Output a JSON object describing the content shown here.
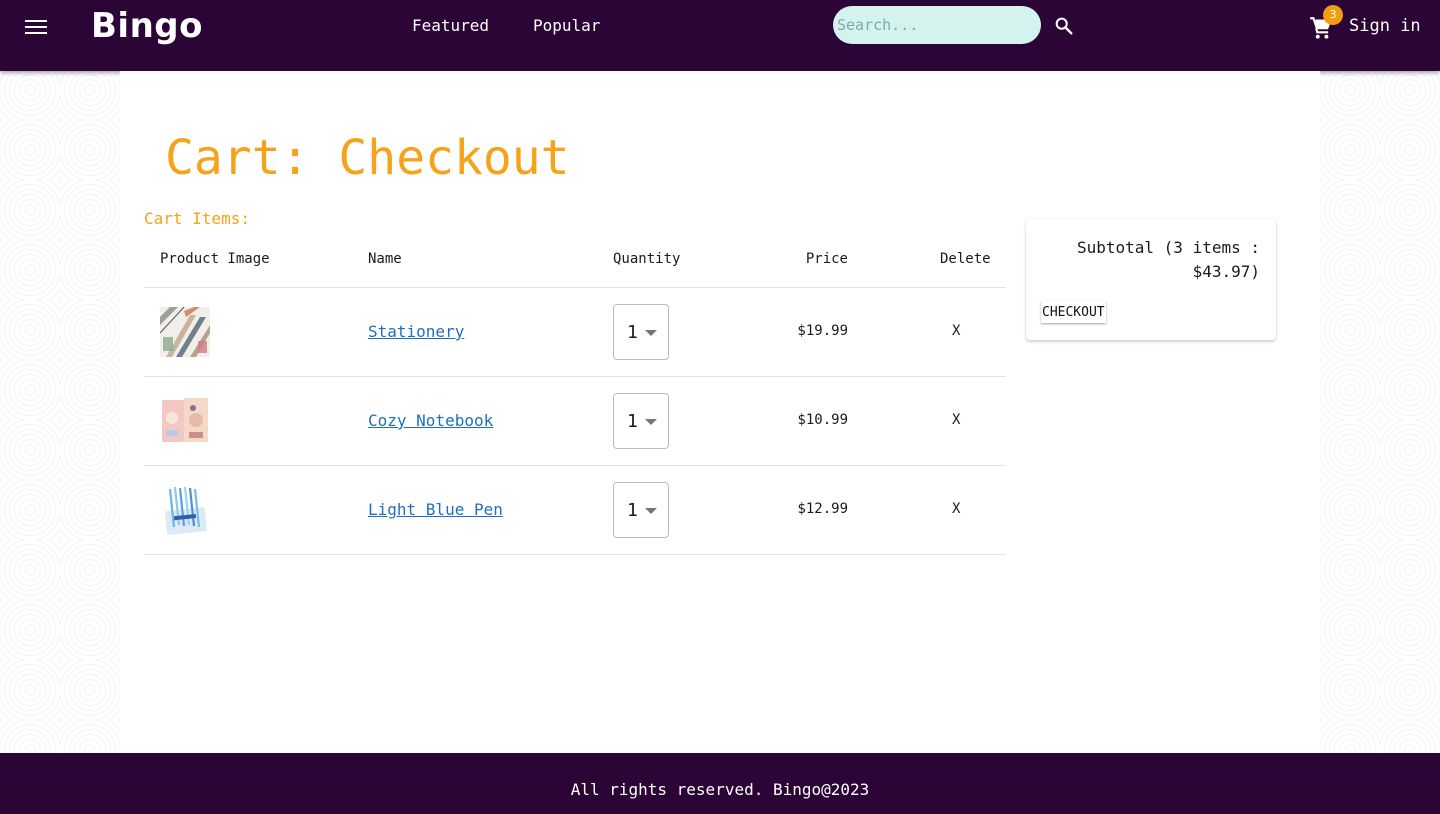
{
  "header": {
    "logo": "Bingo",
    "nav": [
      "Featured",
      "Popular"
    ],
    "search_placeholder": "Search...",
    "cart_count": "3",
    "sign_in": "Sign in"
  },
  "page": {
    "title": "Cart: Checkout",
    "section_label": "Cart Items:"
  },
  "table": {
    "headers": {
      "image": "Product Image",
      "name": "Name",
      "quantity": "Quantity",
      "price": "Price",
      "delete": "Delete"
    },
    "rows": [
      {
        "name": "Stationery",
        "quantity": "1",
        "price": "$19.99",
        "delete": "X"
      },
      {
        "name": "Cozy Notebook",
        "quantity": "1",
        "price": "$10.99",
        "delete": "X"
      },
      {
        "name": "Light Blue Pen",
        "quantity": "1",
        "price": "$12.99",
        "delete": "X"
      }
    ]
  },
  "summary": {
    "subtotal": "Subtotal (3 items : $43.97)",
    "checkout": "CHECKOUT"
  },
  "footer": {
    "text": "All rights reserved. Bingo@2023"
  },
  "colors": {
    "header_bg": "#2b0535",
    "accent": "#f7a21b",
    "link": "#1e6fbf",
    "badge": "#f39c12"
  }
}
